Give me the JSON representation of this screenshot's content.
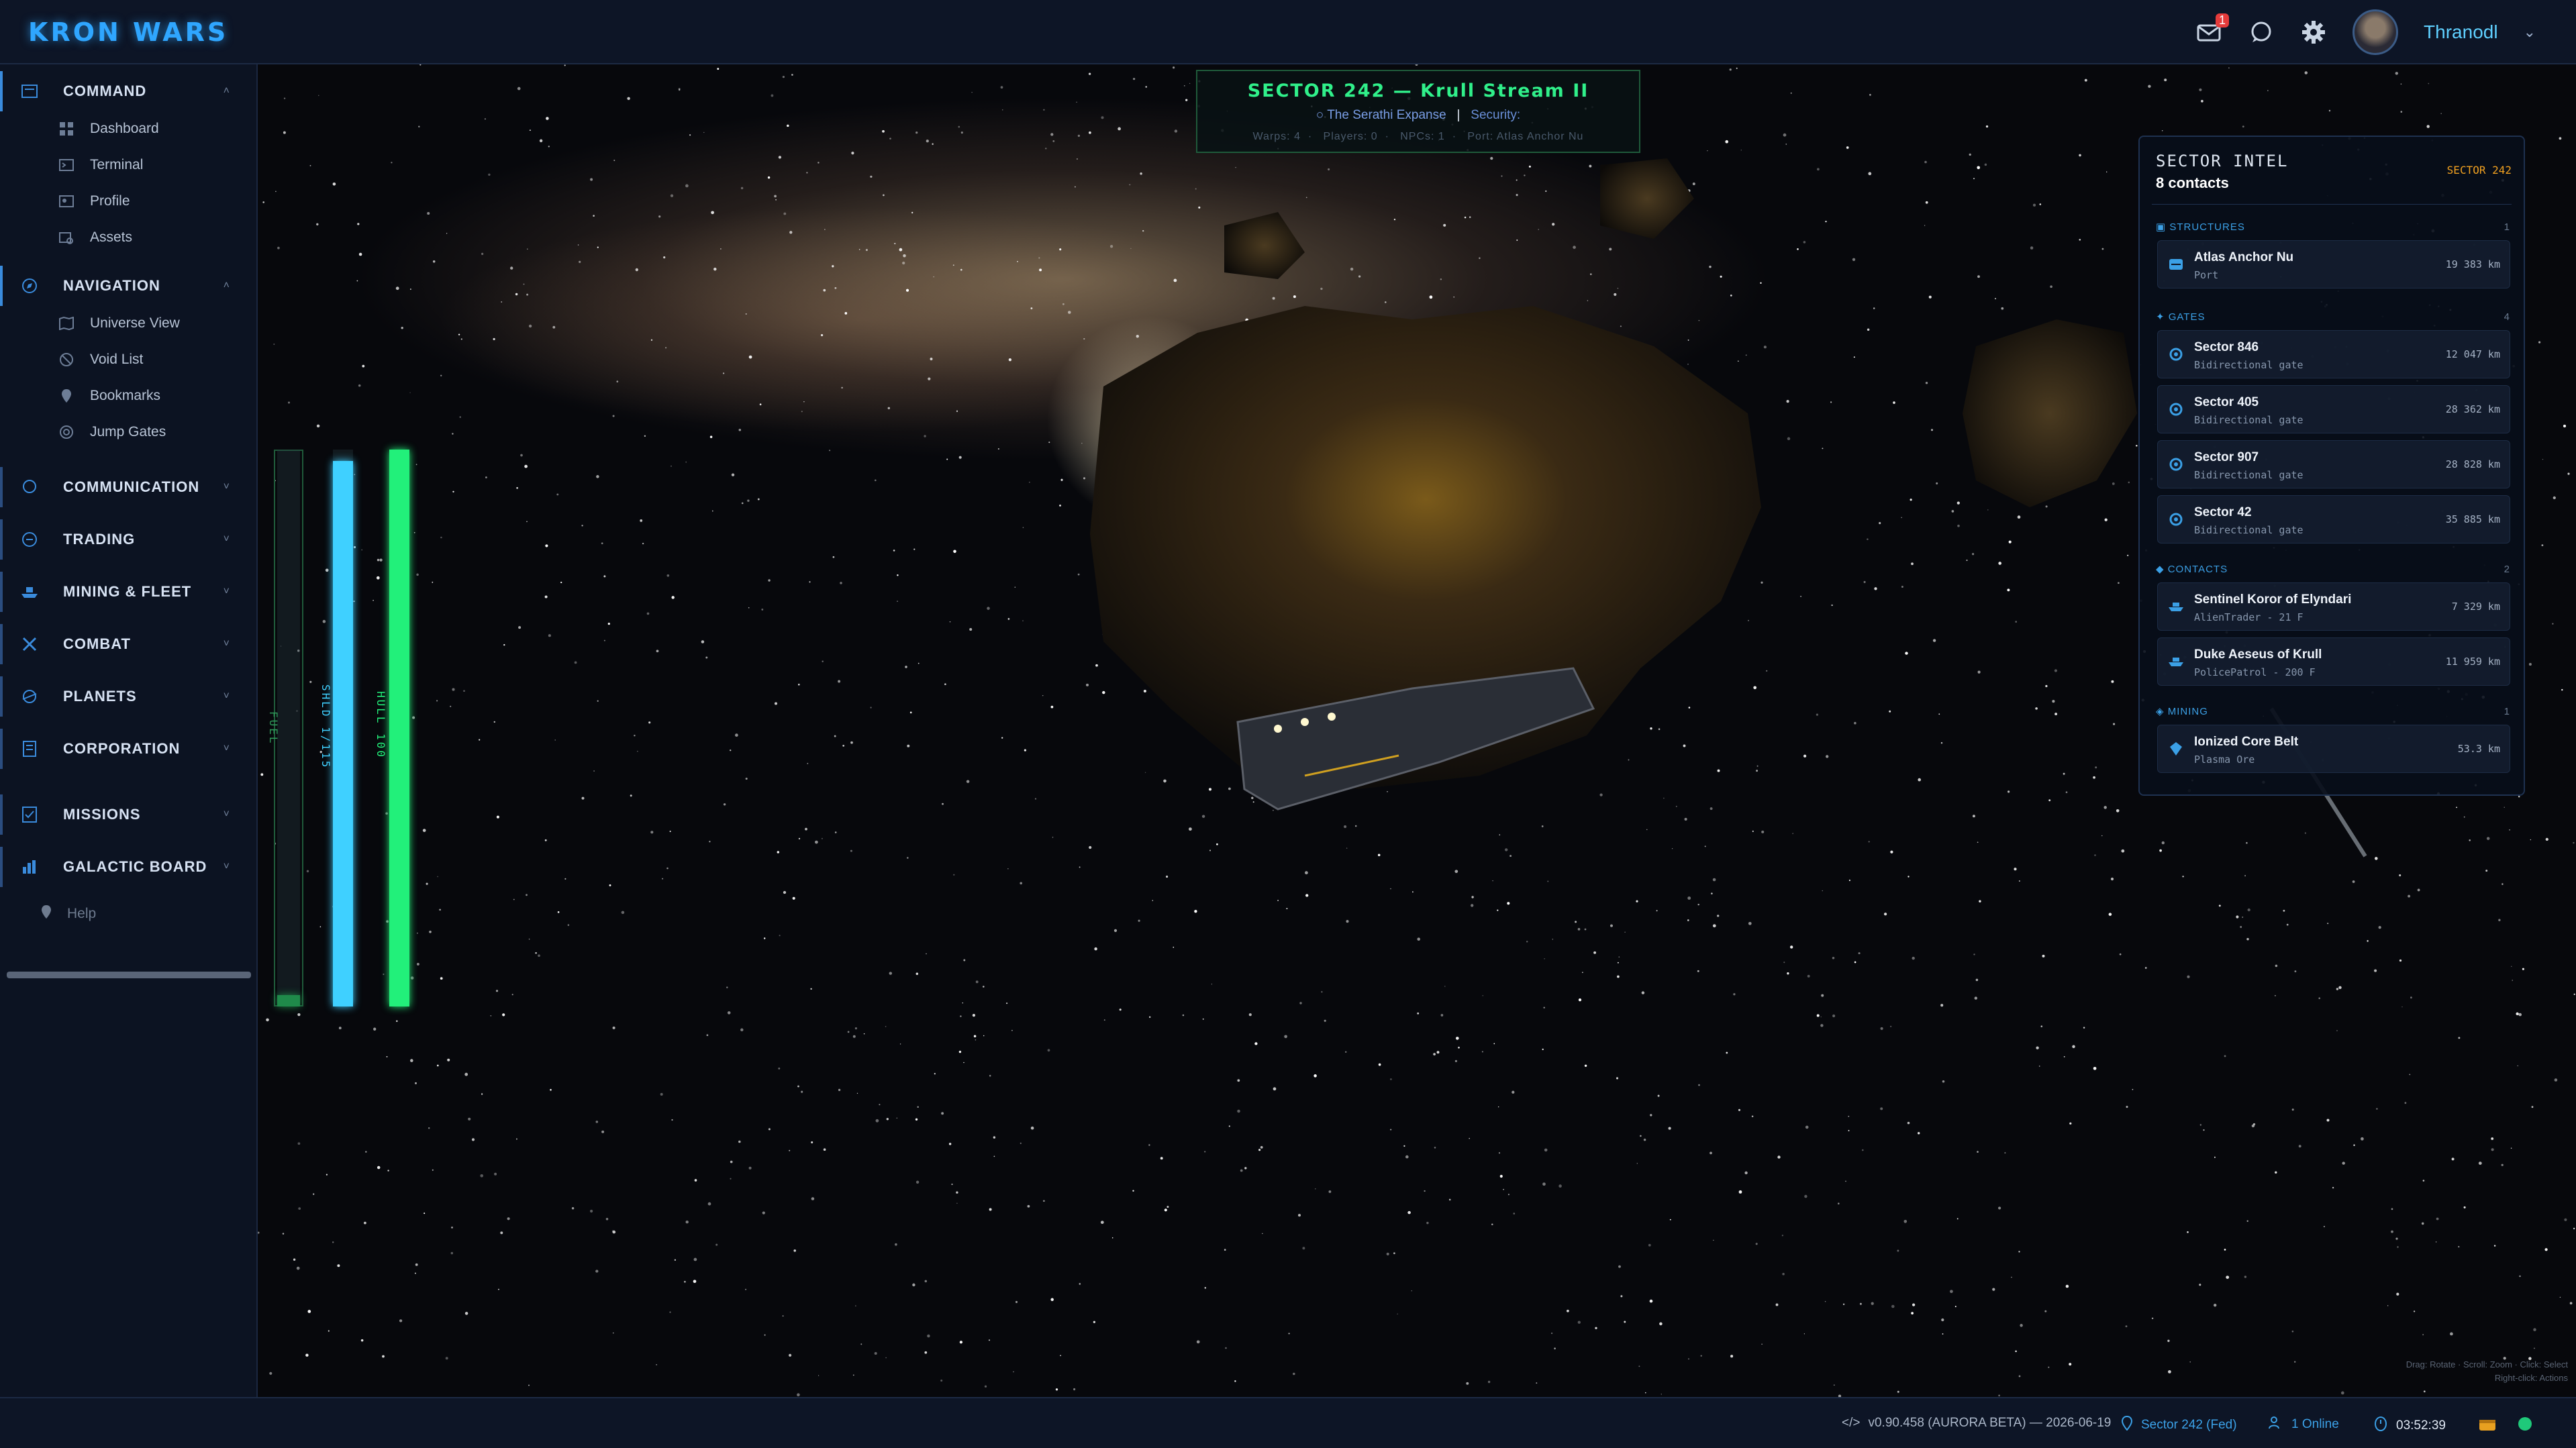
{
  "app": {
    "title": "KRON WARS"
  },
  "header": {
    "mail_badge": "1",
    "username": "Thranodl",
    "icons": [
      "mail-icon",
      "chat-icon",
      "gear-icon",
      "avatar"
    ]
  },
  "sidebar": {
    "sections": [
      {
        "label": "COMMAND",
        "icon": "command-icon",
        "items": [
          {
            "label": "Dashboard",
            "icon": "dashboard-icon"
          },
          {
            "label": "Terminal",
            "icon": "terminal-icon"
          },
          {
            "label": "Profile",
            "icon": "profile-icon"
          },
          {
            "label": "Assets",
            "icon": "assets-icon"
          }
        ]
      },
      {
        "label": "NAVIGATION",
        "icon": "compass-icon",
        "items": [
          {
            "label": "Universe View",
            "icon": "map-icon"
          },
          {
            "label": "Void List",
            "icon": "void-icon"
          },
          {
            "label": "Bookmarks",
            "icon": "bookmark-icon"
          },
          {
            "label": "Jump Gates",
            "icon": "gate-icon"
          }
        ]
      },
      {
        "label": "COMMUNICATION",
        "icon": "chat-icon",
        "items": []
      },
      {
        "label": "TRADING",
        "icon": "trade-icon",
        "items": []
      },
      {
        "label": "MINING & FLEET",
        "icon": "ship-icon",
        "items": []
      },
      {
        "label": "COMBAT",
        "icon": "crosshair-icon",
        "items": []
      },
      {
        "label": "PLANETS",
        "icon": "planet-icon",
        "items": []
      },
      {
        "label": "CORPORATION",
        "icon": "building-icon",
        "items": []
      },
      {
        "label": "MISSIONS",
        "icon": "checklist-icon",
        "items": []
      },
      {
        "label": "GALACTIC BOARD",
        "icon": "board-icon",
        "items": []
      }
    ],
    "help": "Help"
  },
  "gauges": [
    {
      "label": "FUEL",
      "level": 0.02,
      "color": "#1f8a4a"
    },
    {
      "label": "SHLD 1/115",
      "level": 0.98,
      "color": "#3fd0ff"
    },
    {
      "label": "HULL 100",
      "level": 1.0,
      "color": "#22f07a"
    }
  ],
  "sector_banner": {
    "title": "SECTOR 242 — Krull Stream II",
    "region": "The Serathi Expanse",
    "security_label": "Security:",
    "separator": "|",
    "stats": [
      "Warps: 4",
      "Players: 0",
      "NPCs: 1",
      "Port: Atlas Anchor Nu"
    ]
  },
  "sector_intel": {
    "title": "SECTOR INTEL",
    "contacts_count": "8 contacts",
    "sector_tag": "SECTOR 242",
    "categories": [
      {
        "label": "STRUCTURES",
        "count": "1",
        "icon": "structure-icon",
        "rows": [
          {
            "name": "Atlas Anchor Nu",
            "sub": "Port",
            "dist": "19 383 km",
            "icon": "port-icon"
          }
        ]
      },
      {
        "label": "GATES",
        "count": "4",
        "icon": "gate-icon",
        "rows": [
          {
            "name": "Sector 846",
            "sub": "Bidirectional gate",
            "dist": "12 047 km",
            "icon": "gate-icon"
          },
          {
            "name": "Sector 405",
            "sub": "Bidirectional gate",
            "dist": "28 362 km",
            "icon": "gate-icon"
          },
          {
            "name": "Sector 907",
            "sub": "Bidirectional gate",
            "dist": "28 828 km",
            "icon": "gate-icon"
          },
          {
            "name": "Sector 42",
            "sub": "Bidirectional gate",
            "dist": "35 885 km",
            "icon": "gate-icon"
          }
        ]
      },
      {
        "label": "CONTACTS",
        "count": "2",
        "icon": "contact-icon",
        "rows": [
          {
            "name": "Sentinel Koror of Elyndari",
            "sub": "AlienTrader - 21 F",
            "dist": "7 329 km",
            "icon": "ship-icon"
          },
          {
            "name": "Duke Aeseus of Krull",
            "sub": "PolicePatrol - 200 F",
            "dist": "11 959 km",
            "icon": "ship-icon"
          }
        ]
      },
      {
        "label": "MINING",
        "count": "1",
        "icon": "mining-icon",
        "rows": [
          {
            "name": "Ionized Core Belt",
            "sub": "Plasma Ore",
            "dist": "53.3 km",
            "icon": "crystal-icon"
          }
        ]
      }
    ]
  },
  "hint": {
    "line1": "Drag: Rotate · Scroll: Zoom · Click: Select",
    "line2": "Right-click: Actions"
  },
  "statusbar": {
    "version": "v0.90.458 (AURORA BETA) — 2026-06-19",
    "sector": "Sector 242 (Fed)",
    "online": "1 Online",
    "clock": "03:52:39"
  },
  "colors": {
    "accent": "#2fa6ff",
    "sector_title": "#30f08a",
    "intel_tag": "#f0a020"
  }
}
